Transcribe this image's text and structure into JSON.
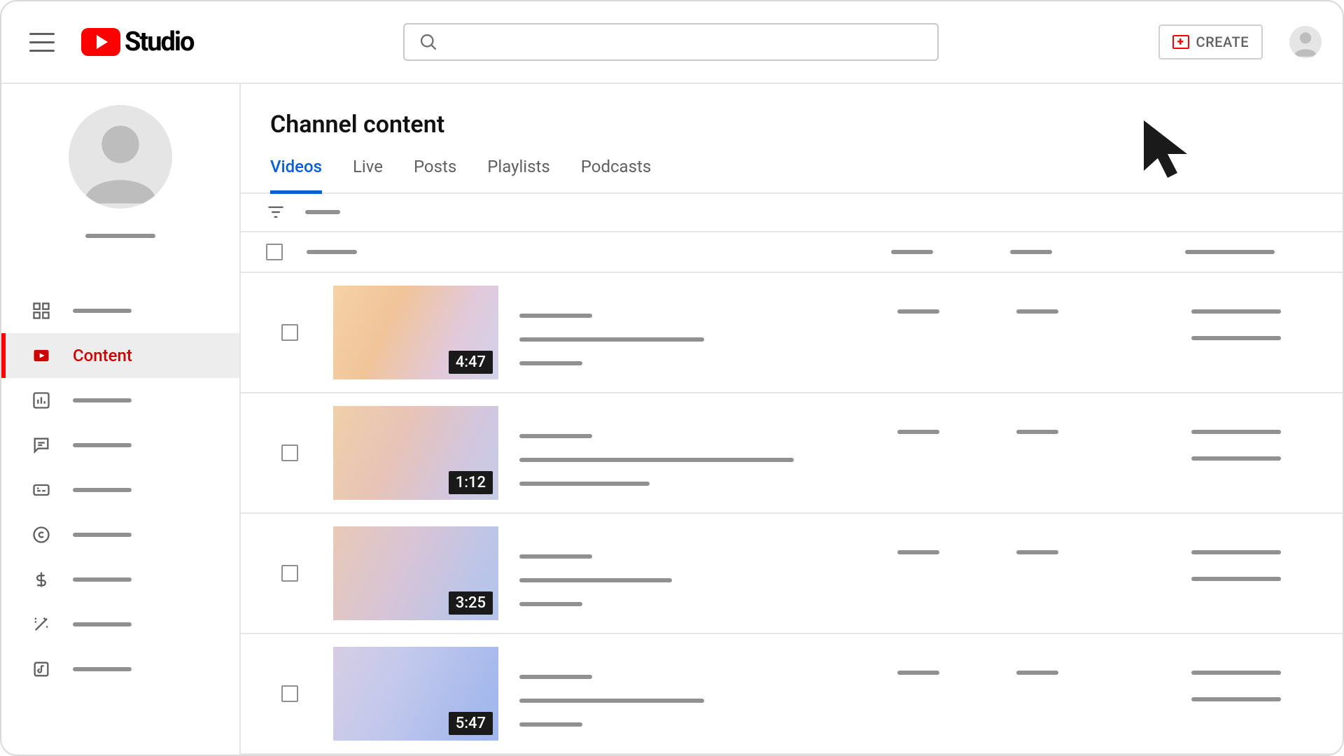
{
  "header": {
    "logo_text": "Studio",
    "create_label": "CREATE"
  },
  "sidebar": {
    "active_label": "Content"
  },
  "main": {
    "title": "Channel content",
    "tabs": [
      "Videos",
      "Live",
      "Posts",
      "Playlists",
      "Podcasts"
    ],
    "active_tab": 0
  },
  "rows": [
    {
      "duration": "4:47",
      "grad": "g0"
    },
    {
      "duration": "1:12",
      "grad": "g1"
    },
    {
      "duration": "3:25",
      "grad": "g2"
    },
    {
      "duration": "5:47",
      "grad": "g3"
    }
  ]
}
